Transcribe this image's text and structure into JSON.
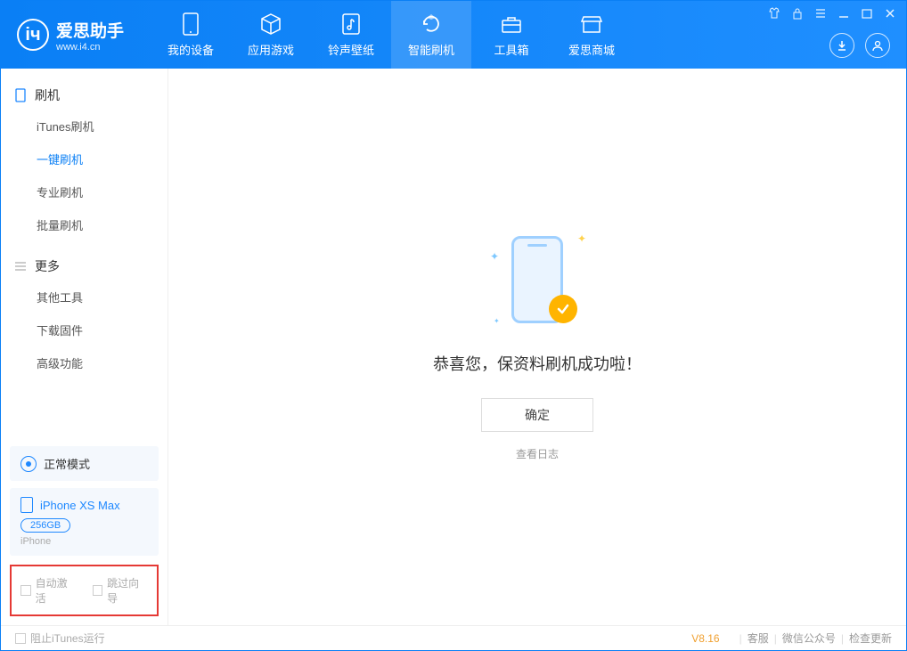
{
  "header": {
    "logo_title": "爱思助手",
    "logo_sub": "www.i4.cn",
    "nav": [
      {
        "label": "我的设备",
        "icon": "device"
      },
      {
        "label": "应用游戏",
        "icon": "cube"
      },
      {
        "label": "铃声壁纸",
        "icon": "music"
      },
      {
        "label": "智能刷机",
        "icon": "refresh",
        "active": true
      },
      {
        "label": "工具箱",
        "icon": "toolbox"
      },
      {
        "label": "爱思商城",
        "icon": "store"
      }
    ]
  },
  "sidebar": {
    "group1": {
      "title": "刷机"
    },
    "items1": [
      "iTunes刷机",
      "一键刷机",
      "专业刷机",
      "批量刷机"
    ],
    "active_item": "一键刷机",
    "group2": {
      "title": "更多"
    },
    "items2": [
      "其他工具",
      "下载固件",
      "高级功能"
    ],
    "mode": "正常模式",
    "device": {
      "name": "iPhone XS Max",
      "capacity": "256GB",
      "type": "iPhone"
    },
    "options": {
      "auto_activate": "自动激活",
      "skip_guide": "跳过向导"
    }
  },
  "main": {
    "success_text": "恭喜您，保资料刷机成功啦！",
    "ok_button": "确定",
    "log_link": "查看日志"
  },
  "footer": {
    "block_itunes": "阻止iTunes运行",
    "version": "V8.16",
    "links": [
      "客服",
      "微信公众号",
      "检查更新"
    ]
  }
}
